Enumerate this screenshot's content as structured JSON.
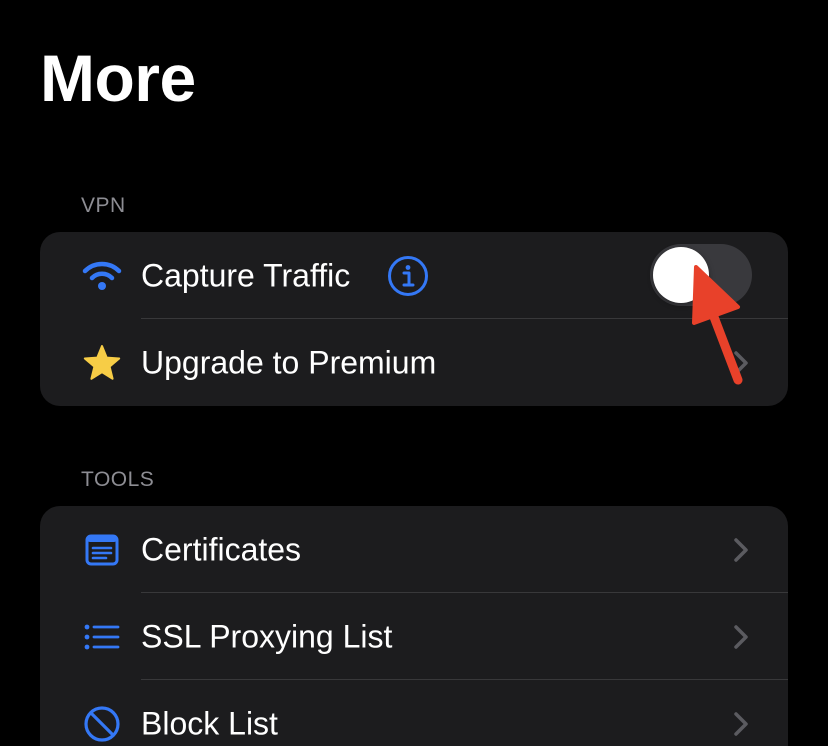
{
  "page": {
    "title": "More"
  },
  "sections": {
    "vpn": {
      "header": "VPN",
      "rows": {
        "capture_traffic": {
          "icon": "wifi-icon",
          "label": "Capture Traffic",
          "info_icon": "info-circle-icon",
          "toggle_on": false
        },
        "upgrade": {
          "icon": "star-icon",
          "label": "Upgrade to Premium",
          "accessory": "chevron-right-icon"
        }
      }
    },
    "tools": {
      "header": "TOOLS",
      "rows": {
        "certificates": {
          "icon": "document-icon",
          "label": "Certificates",
          "accessory": "chevron-right-icon"
        },
        "ssl_proxying": {
          "icon": "list-icon",
          "label": "SSL Proxying List",
          "accessory": "chevron-right-icon"
        },
        "block_list": {
          "icon": "block-icon",
          "label": "Block List",
          "accessory": "chevron-right-icon"
        }
      }
    }
  },
  "colors": {
    "background": "#000000",
    "group_background": "#1c1c1e",
    "accent_blue": "#3478f6",
    "star_yellow": "#f7cd46",
    "annotation_red": "#e8412a",
    "secondary_text": "#8d8d93"
  }
}
